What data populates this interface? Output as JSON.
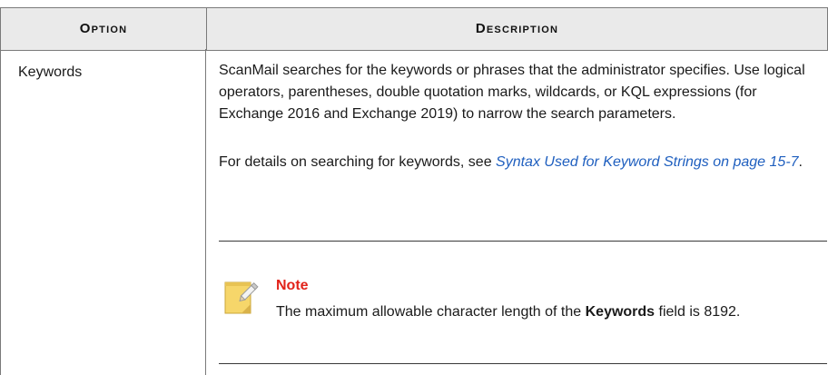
{
  "table": {
    "headers": {
      "option": "Option",
      "description": "Description"
    },
    "row": {
      "option": "Keywords",
      "paragraph1": "ScanMail searches for the keywords or phrases that the administrator specifies. Use logical operators, parentheses, double quotation marks, wildcards, or KQL expressions (for Exchange 2016 and Exchange 2019) to narrow the search parameters.",
      "paragraph2_prefix": "For details on searching for keywords, see ",
      "paragraph2_link": "Syntax Used for Keyword Strings on page 15-7",
      "paragraph2_suffix": ".",
      "note": {
        "title": "Note",
        "body_prefix": "The maximum allowable character length of the ",
        "body_bold": "Keywords",
        "body_suffix": " field is 8192.",
        "icon": "note-pencil-icon"
      }
    }
  }
}
